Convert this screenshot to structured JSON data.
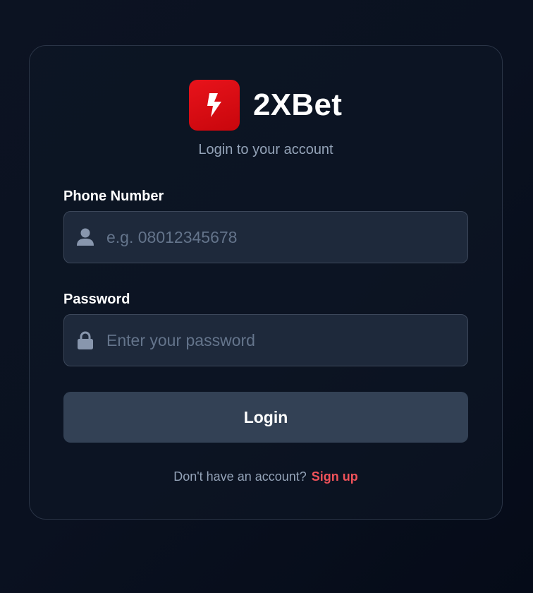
{
  "brand": {
    "name": "2XBet",
    "logo_icon": "lightning-bolt-icon",
    "accent_color": "#d90b12"
  },
  "subtitle": "Login to your account",
  "phone": {
    "label": "Phone Number",
    "placeholder": "e.g. 08012345678",
    "icon": "user-icon"
  },
  "password": {
    "label": "Password",
    "placeholder": "Enter your password",
    "icon": "lock-icon"
  },
  "login_button": "Login",
  "signup": {
    "prompt": "Don't have an account?",
    "link": "Sign up",
    "link_color": "#f0525a"
  }
}
